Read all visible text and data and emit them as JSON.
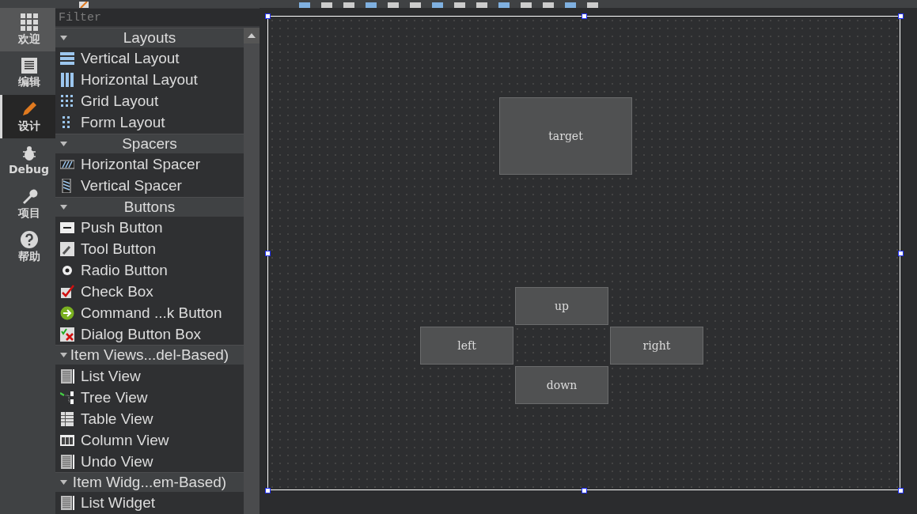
{
  "modes": [
    {
      "label": "欢迎",
      "selected": false,
      "hovered": true
    },
    {
      "label": "编辑",
      "selected": false,
      "hovered": false
    },
    {
      "label": "设计",
      "selected": true,
      "hovered": false
    },
    {
      "label": "Debug",
      "selected": false,
      "hovered": false
    },
    {
      "label": "项目",
      "selected": false,
      "hovered": false
    },
    {
      "label": "帮助",
      "selected": false,
      "hovered": false
    }
  ],
  "widget_box": {
    "filter": {
      "placeholder": "Filter"
    },
    "categories": [
      {
        "title": "Layouts",
        "expanded": true,
        "items": [
          "Vertical Layout",
          "Horizontal Layout",
          "Grid Layout",
          "Form Layout"
        ]
      },
      {
        "title": "Spacers",
        "expanded": true,
        "items": [
          "Horizontal Spacer",
          "Vertical Spacer"
        ]
      },
      {
        "title": "Buttons",
        "expanded": true,
        "items": [
          "Push Button",
          "Tool Button",
          "Radio Button",
          "Check Box",
          "Command ...k Button",
          "Dialog Button Box"
        ]
      },
      {
        "title": "Item Views...del-Based)",
        "expanded": true,
        "items": [
          "List View",
          "Tree View",
          "Table View",
          "Column View",
          "Undo View"
        ]
      },
      {
        "title": "Item Widg...em-Based)",
        "expanded": true,
        "items": [
          "List Widget"
        ]
      }
    ]
  },
  "form": {
    "selected": true,
    "buttons": [
      "target",
      "up",
      "left",
      "right",
      "down"
    ]
  }
}
